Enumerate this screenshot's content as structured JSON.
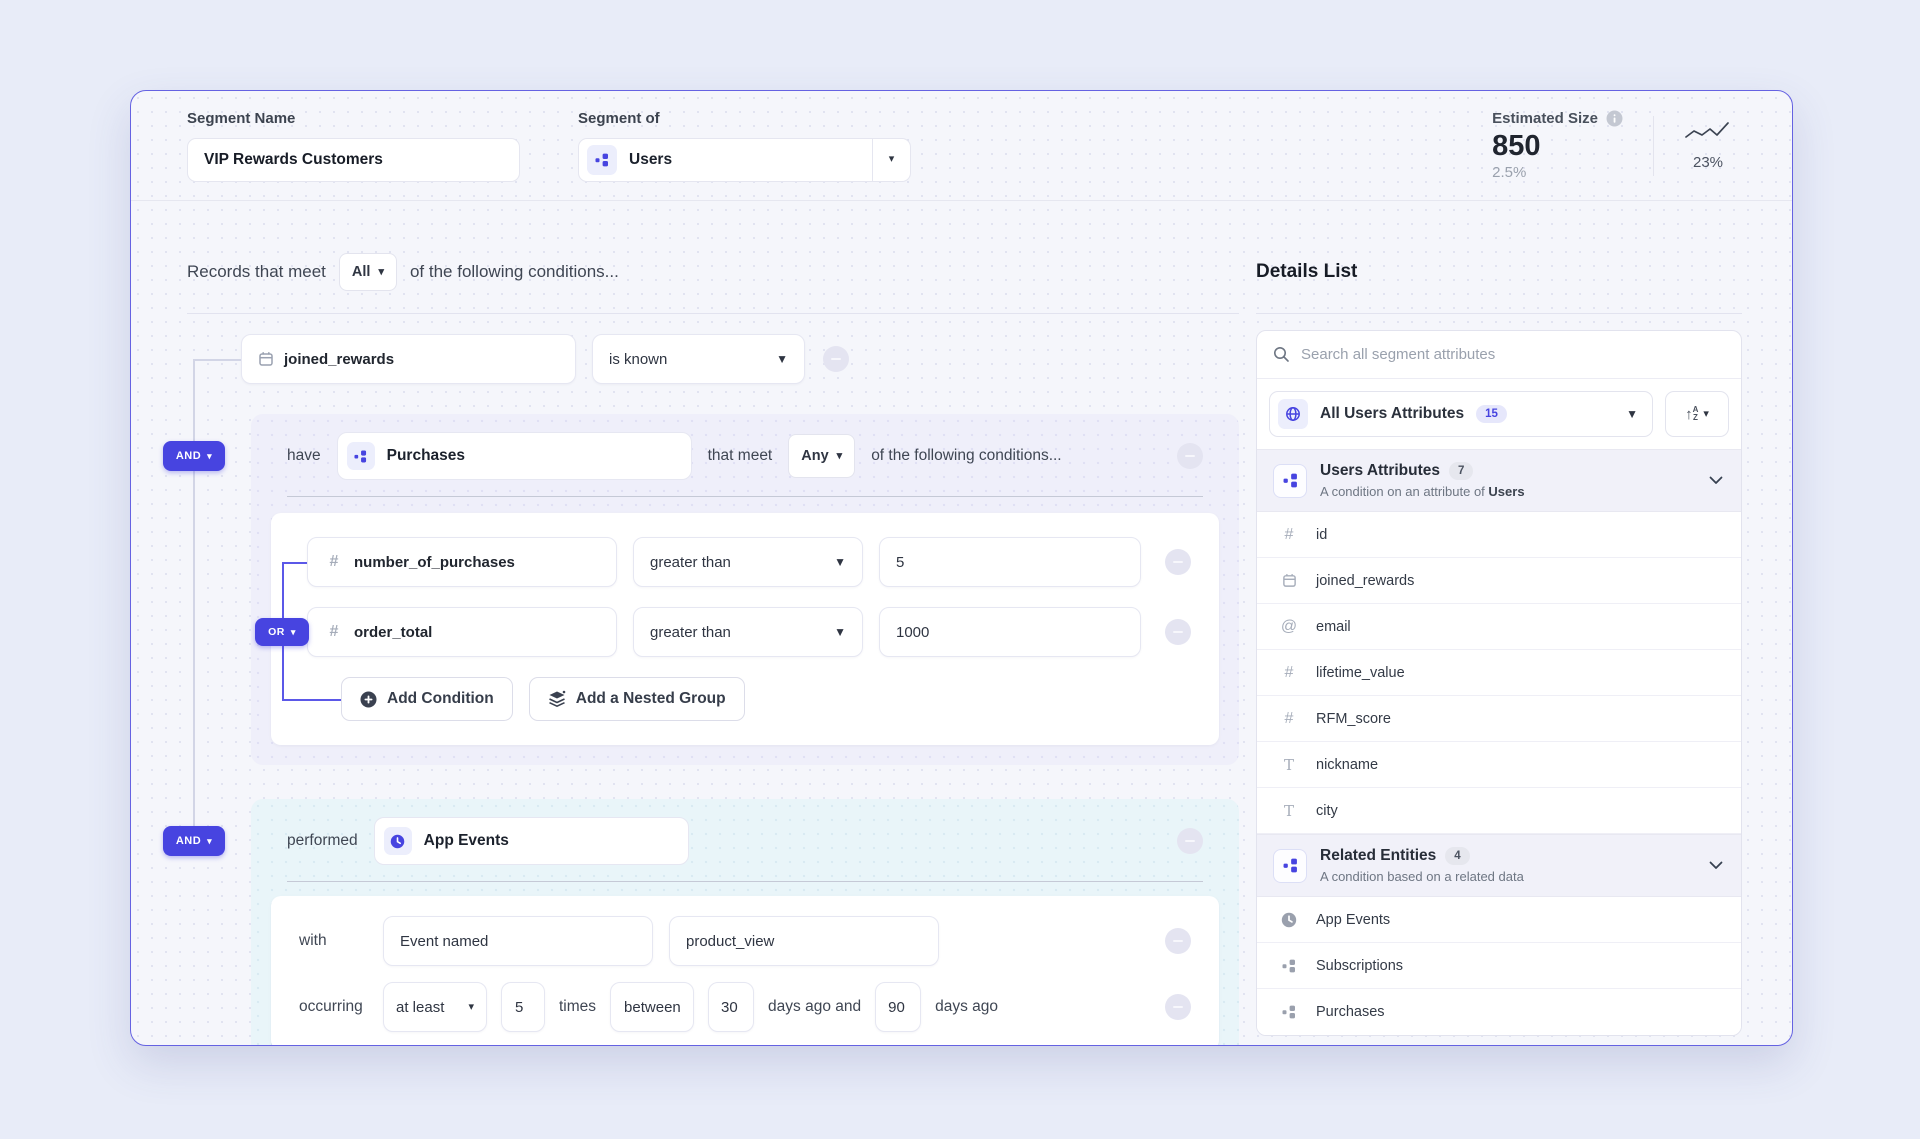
{
  "header": {
    "segment_name_label": "Segment Name",
    "segment_name_value": "VIP Rewards Customers",
    "segment_of_label": "Segment of",
    "segment_of_value": "Users",
    "estimated": {
      "label": "Estimated Size",
      "value": "850",
      "percent": "2.5%"
    },
    "trend": "23%"
  },
  "builder": {
    "intro": {
      "prefix": "Records that meet",
      "selector": "All",
      "suffix": "of the following conditions..."
    },
    "condition1": {
      "field": "joined_rewards",
      "operator": "is known"
    },
    "group1": {
      "badge": "AND",
      "lead": "have",
      "entity": "Purchases",
      "mid": "that meet",
      "selector": "Any",
      "suffix": "of the following conditions...",
      "or_badge": "OR",
      "rows": [
        {
          "field": "number_of_purchases",
          "operator": "greater than",
          "value": "5"
        },
        {
          "field": "order_total",
          "operator": "greater than",
          "value": "1000"
        }
      ],
      "add_condition": "Add Condition",
      "add_nested": "Add a Nested Group"
    },
    "group2": {
      "badge": "AND",
      "lead": "performed",
      "entity": "App Events",
      "with_label": "with",
      "event_named": "Event named",
      "event_value": "product_view",
      "occurring_label": "occurring",
      "occurring_op": "at least",
      "occurring_count": "5",
      "times_label": "times",
      "between_label": "between",
      "from_value": "30",
      "and_label": "days ago and",
      "to_value": "90",
      "ago_label": "days ago"
    }
  },
  "sidebar": {
    "title": "Details List",
    "search_placeholder": "Search all segment attributes",
    "filter_label": "All Users Attributes",
    "filter_count": "15",
    "sections": [
      {
        "title": "Users Attributes",
        "count": "7",
        "subtitle": "A condition on an attribute of ",
        "subtitle_bold": "Users",
        "items": [
          "id",
          "joined_rewards",
          "email",
          "lifetime_value",
          "RFM_score",
          "nickname",
          "city"
        ]
      },
      {
        "title": "Related Entities",
        "count": "4",
        "subtitle": "A condition based on a related data",
        "subtitle_bold": "",
        "items": [
          "App Events",
          "Subscriptions",
          "Purchases"
        ]
      }
    ]
  },
  "colors": {
    "accent": "#4744e0",
    "card_border": "#6562e2",
    "group1_bg": "#efeffa",
    "group2_bg": "#e9f5f9",
    "page_bg": "#e8ecf8"
  }
}
